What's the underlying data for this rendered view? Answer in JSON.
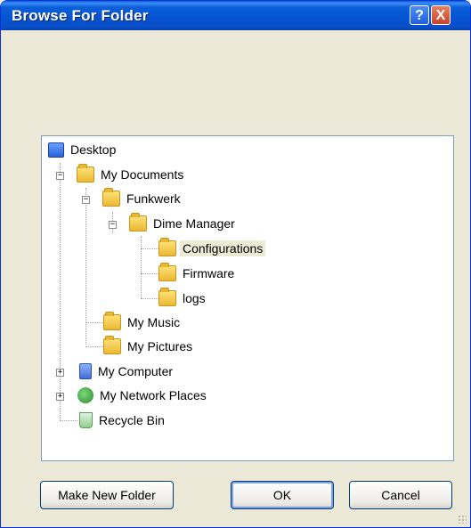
{
  "window": {
    "title": "Browse For Folder"
  },
  "titlebar_buttons": {
    "help": "?",
    "close": "X"
  },
  "tree": {
    "items": [
      {
        "label": "Desktop",
        "icon": "desktop-icon"
      },
      {
        "label": "My Documents",
        "icon": "documents-folder-icon",
        "expander": "−"
      },
      {
        "label": "Funkwerk",
        "icon": "folder-icon",
        "expander": "−"
      },
      {
        "label": "Dime Manager",
        "icon": "folder-icon",
        "expander": "−"
      },
      {
        "label": "Configurations",
        "icon": "folder-open-icon",
        "selected": true
      },
      {
        "label": "Firmware",
        "icon": "folder-icon"
      },
      {
        "label": "logs",
        "icon": "folder-icon"
      },
      {
        "label": "My Music",
        "icon": "music-folder-icon"
      },
      {
        "label": "My Pictures",
        "icon": "pictures-folder-icon"
      },
      {
        "label": "My Computer",
        "icon": "computer-icon",
        "expander": "+"
      },
      {
        "label": "My Network Places",
        "icon": "network-icon",
        "expander": "+"
      },
      {
        "label": "Recycle Bin",
        "icon": "recycle-bin-icon"
      }
    ]
  },
  "buttons": {
    "make_new_folder": "Make New Folder",
    "ok": "OK",
    "cancel": "Cancel"
  },
  "colors": {
    "titlebar": "#0a5fd8",
    "dialog_bg": "#ece9d8",
    "selection": "#ecebd6"
  }
}
